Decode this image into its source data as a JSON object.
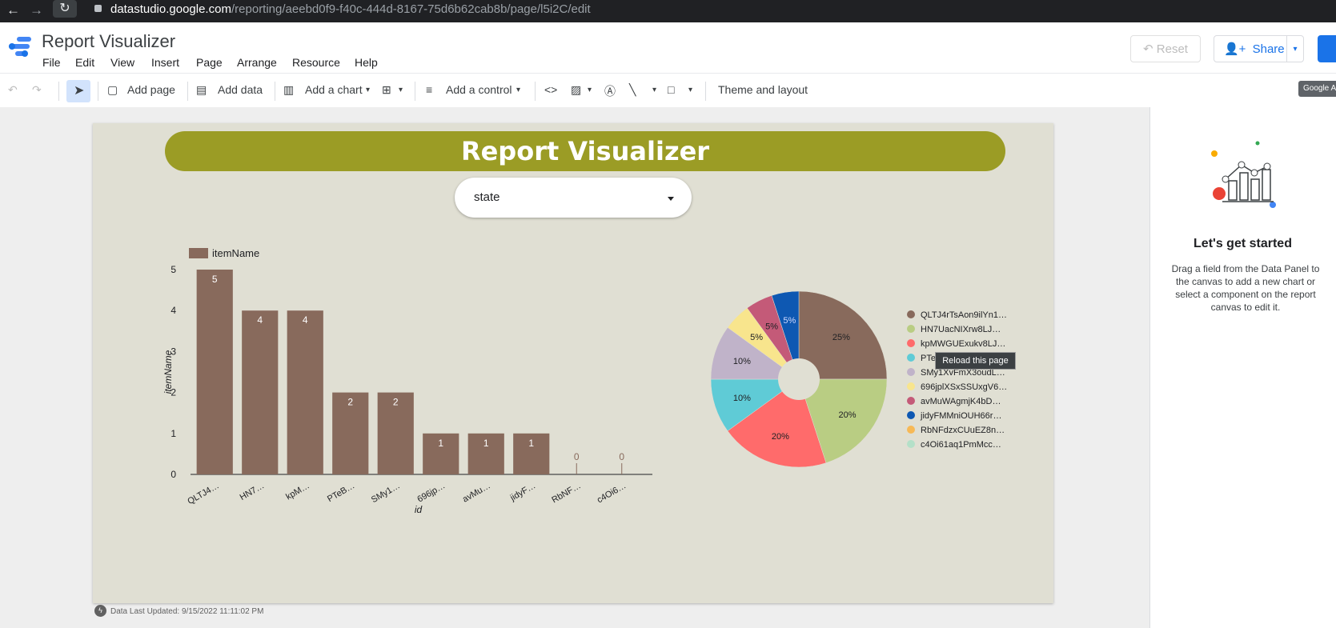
{
  "browser": {
    "url_domain": "datastudio.google.com",
    "url_path": "/reporting/aeebd0f9-f40c-444d-8167-75d6b62cab8b/page/l5i2C/edit"
  },
  "header": {
    "title": "Report Visualizer",
    "menu": [
      "File",
      "Edit",
      "View",
      "Insert",
      "Page",
      "Arrange",
      "Resource",
      "Help"
    ],
    "reset_label": "Reset",
    "share_label": "Share",
    "tooltip": "Google A"
  },
  "toolbar": {
    "add_page": "Add page",
    "add_data": "Add data",
    "add_chart": "Add a chart",
    "add_control": "Add a control",
    "theme_layout": "Theme and layout"
  },
  "report": {
    "title": "Report Visualizer",
    "filter_label": "state",
    "footer": "Data Last Updated: 9/15/2022 11:11:02 PM"
  },
  "side_panel": {
    "heading": "Let's get started",
    "description": "Drag a field from the Data Panel to the canvas to add a new chart or select a component on the report canvas to edit it."
  },
  "tooltip_reload": "Reload this page",
  "colors": {
    "banner": "#9b9c25",
    "bar": "#886a5c",
    "page_bg": "#e0dfd3",
    "accent": "#1a73e8"
  },
  "chart_data": [
    {
      "type": "bar",
      "legend": "itemName",
      "xlabel": "id",
      "ylabel": "itemName",
      "ylim": [
        0,
        5
      ],
      "yticks": [
        "0",
        "1",
        "2",
        "3",
        "4",
        "5"
      ],
      "categories": [
        "QLTJ4…",
        "HN7…",
        "kpM…",
        "PTeB…",
        "SMy1…",
        "696jp…",
        "avMu…",
        "jidyF…",
        "RbNF…",
        "c4Oi6…"
      ],
      "values": [
        5,
        4,
        4,
        2,
        2,
        1,
        1,
        1,
        0,
        0
      ],
      "grid": false
    },
    {
      "type": "pie",
      "donut": true,
      "labels": [
        "QLTJ4rTsAon9ilYn1…",
        "HN7UacNIXrw8LJ…",
        "kpMWGUExukv8LJ…",
        "PTeBa",
        "SMy1XvFmX3oudL…",
        "696jplXSxSSUxgV6…",
        "avMuWAgmjK4bD…",
        "jidyFMMniOUH66r…",
        "RbNFdzxCUuEZ8n…",
        "c4Oi61aq1PmMcc…"
      ],
      "values": [
        25,
        20,
        20,
        10,
        10,
        5,
        5,
        5,
        0,
        0
      ],
      "value_labels": [
        "25%",
        "20%",
        "20%",
        "10%",
        "10%",
        "5%",
        "5%",
        "5%",
        "",
        ""
      ],
      "colors": [
        "#886a5c",
        "#b9cd83",
        "#ff6b6b",
        "#5fcbd6",
        "#c0b3c9",
        "#f8e58d",
        "#c45a78",
        "#0e58b2",
        "#f7b956",
        "#b4e0c8"
      ],
      "legend_position": "right"
    }
  ]
}
